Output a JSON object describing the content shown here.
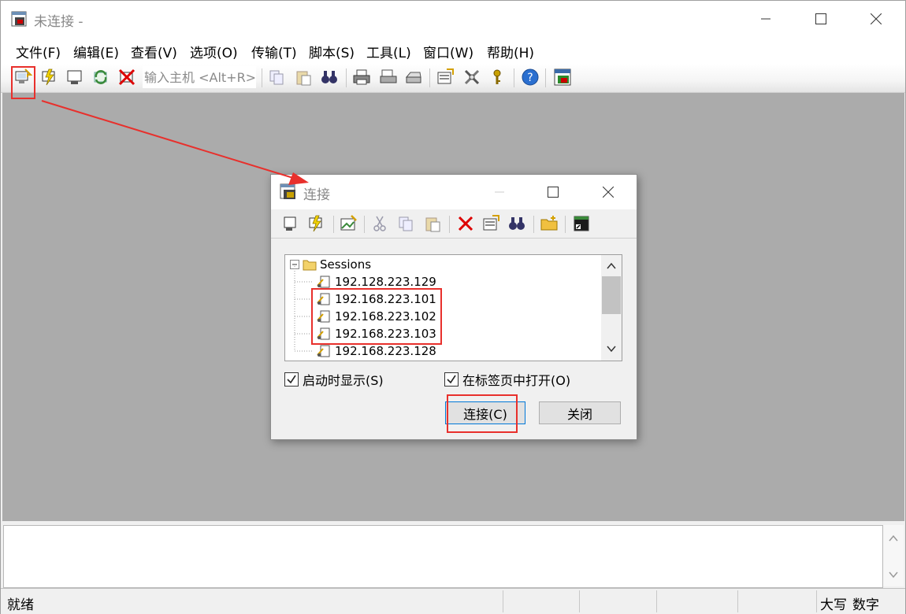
{
  "window": {
    "title": "未连接 -"
  },
  "menu": [
    "文件(F)",
    "编辑(E)",
    "查看(V)",
    "选项(O)",
    "传输(T)",
    "脚本(S)",
    "工具(L)",
    "窗口(W)",
    "帮助(H)"
  ],
  "toolbar": {
    "host_placeholder": "输入主机 <Alt+R>"
  },
  "dialog": {
    "title": "连接",
    "tree_root": "Sessions",
    "sessions": [
      "192.128.223.129",
      "192.168.223.101",
      "192.168.223.102",
      "192.168.223.103",
      "192.168.223.128"
    ],
    "show_on_startup_label": "启动时显示(S)",
    "show_on_startup_checked": true,
    "open_in_tab_label": "在标签页中打开(O)",
    "open_in_tab_checked": true,
    "connect_label": "连接(C)",
    "close_label": "关闭"
  },
  "status": {
    "text": "就绪",
    "caps": "大写",
    "num": "数字"
  },
  "colors": {
    "workspace": "#ababab",
    "annotation": "#e8302c",
    "accent": "#0078d7"
  }
}
